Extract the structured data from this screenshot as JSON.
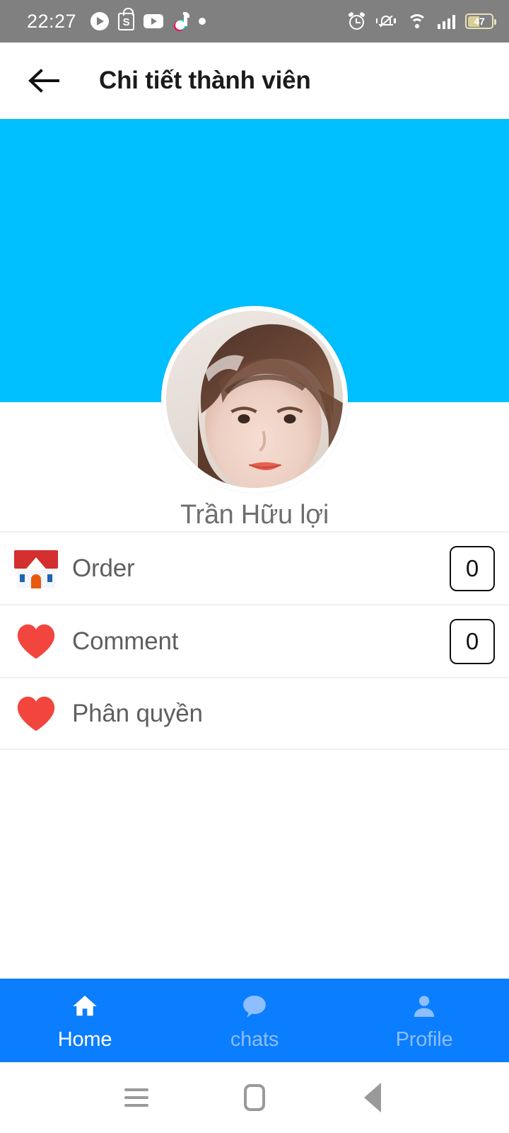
{
  "status_bar": {
    "time": "22:27",
    "battery_level": "47",
    "left_icons": [
      "play-icon",
      "shopee-icon",
      "youtube-icon",
      "tiktok-icon",
      "dot-icon"
    ],
    "right_icons": [
      "alarm-icon",
      "mute-bell-icon",
      "wifi-icon",
      "signal-icon",
      "battery-icon"
    ],
    "shopee_letter": "S",
    "background_color": "#808080"
  },
  "app_bar": {
    "back_icon": "back-arrow-icon",
    "title": "Chi tiết thành viên"
  },
  "profile": {
    "banner_color": "#00BFFF",
    "avatar_alt": "user-avatar-photo",
    "name": "Trần Hữu lợi"
  },
  "list": {
    "rows": [
      {
        "icon": "house-emoji",
        "emoji": "🏠",
        "label": "Order",
        "badge": "0",
        "has_badge": true
      },
      {
        "icon": "heart-emoji",
        "emoji": "❤️",
        "label": "Comment",
        "badge": "0",
        "has_badge": true
      },
      {
        "icon": "heart-emoji",
        "emoji": "❤️",
        "label": "Phân quyền",
        "badge": "",
        "has_badge": false
      }
    ]
  },
  "bottom_nav": {
    "background_color": "#0B7DFF",
    "active_color": "#FFFFFF",
    "inactive_color": "#8DBEFF",
    "items": [
      {
        "icon": "home-icon",
        "label": "Home",
        "active": true
      },
      {
        "icon": "chat-bubble-icon",
        "label": "chats",
        "active": false
      },
      {
        "icon": "person-icon",
        "label": "Profile",
        "active": false
      }
    ]
  },
  "system_nav": {
    "recents_icon": "menu-icon",
    "home_icon": "home-square-icon",
    "back_icon": "back-triangle-icon"
  }
}
